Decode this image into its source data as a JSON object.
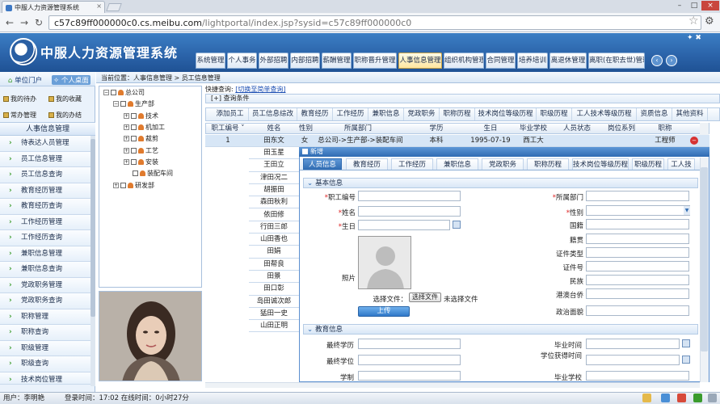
{
  "browser": {
    "tab_title": "中服人力资源管理系统",
    "tab_close": "×",
    "url_host": "c57c89ff000000c0.cs.meibu.com",
    "url_path": "/lightportal/index.jsp?sysid=c57c89ff000000c0",
    "win_min": "–",
    "win_max": "□",
    "win_close": "×"
  },
  "header": {
    "title": "中服人力资源管理系统",
    "top_icons": "✦ ✖",
    "nav": [
      "系统管理",
      "个人事务",
      "外部招聘",
      "内部招聘",
      "薪酬管理",
      "职称晋升管理",
      "人事信息管理",
      "组织机构管理",
      "合同管理",
      "培养培训",
      "离退休管理",
      "离职(在职去世)管理"
    ],
    "active_nav": "人事信息管理",
    "prev": "‹",
    "next": "›"
  },
  "left": {
    "portal": "单位门户",
    "personal_desk": "个人桌面",
    "quick": [
      "我的待办",
      "我的收藏",
      "常办管理",
      "我的办结"
    ],
    "menu_title": "人事信息管理",
    "menu": [
      "待表达人员管理",
      "员工信息管理",
      "员工信息查询",
      "教育经历管理",
      "教育经历查询",
      "工作经历管理",
      "工作经历查询",
      "兼职信息管理",
      "兼职信息查询",
      "党政职务管理",
      "党政职务查询",
      "职称管理",
      "职称查询",
      "职级管理",
      "职级查询",
      "技术岗位管理"
    ]
  },
  "breadcrumb": "当前位置：人事信息管理 > 员工信息管理",
  "tree": {
    "root": "总公司",
    "dept1": "生产部",
    "children": [
      "技术",
      "机加工",
      "裁剪",
      "工艺",
      "安装",
      "装配车间"
    ],
    "dept2": "研发部"
  },
  "query": {
    "quick_label": "快捷查询:",
    "switch_link": "[切换至简单查询]",
    "toggle": "[+]",
    "cond_label": "查询条件"
  },
  "subtabs": [
    "添加员工",
    "员工信息综改",
    "教育经历",
    "工作经历",
    "兼职信息",
    "党政职务",
    "职称历程",
    "技术岗位等级历程",
    "职级历程",
    "工人技术等级历程",
    "资质信息",
    "其他资料"
  ],
  "grid": {
    "columns": [
      "职工编号",
      "姓名",
      "性别",
      "所属部门",
      "学历",
      "生日",
      "毕业学校",
      "人员状态",
      "岗位系列",
      "职称"
    ],
    "sort_mark": "˅",
    "row1": [
      "1",
      "田东文",
      "女",
      "总公司->生产部->装配车间",
      "本科",
      "1995-07-19",
      "西工大",
      "",
      "",
      "工程师"
    ],
    "delete_icon": "−",
    "names": [
      "田玉星",
      "王田立",
      "津田况二",
      "胡振田",
      "森田秋利",
      "依田修",
      "行田三郎",
      "山田香也",
      "田娟",
      "田帮良",
      "田景",
      "田口彰",
      "岛田诚次郎",
      "猛田一史",
      "山田正明"
    ]
  },
  "modal": {
    "title": "新增",
    "tabs": [
      "人员信息",
      "教育经历",
      "工作经历",
      "兼职信息",
      "党政职务",
      "职称历程",
      "技术岗位等级历程",
      "职级历程",
      "工人技"
    ],
    "active_tab": "人员信息",
    "section1": "基本信息",
    "section2": "教育信息",
    "arrow": "⌄",
    "req": "*",
    "labels_left": [
      "职工编号",
      "姓名",
      "生日"
    ],
    "labels_right_req": [
      "所属部门",
      "性别"
    ],
    "labels_right": [
      "国籍",
      "籍贯",
      "证件类型",
      "证件号",
      "民族",
      "港澳台侨",
      "政治面貌"
    ],
    "photo_label": "照片",
    "choose_file_label": "选择文件：",
    "choose_file_btn": "选择文件",
    "no_file": "未选择文件",
    "upload": "上传",
    "edu_left": [
      "最终学历",
      "最终学位",
      "学制"
    ],
    "edu_right": [
      "毕业时间",
      "学位获得时间",
      "毕业学校"
    ]
  },
  "status": {
    "user": "用户：李明艳",
    "login": "登录时间：17:02 在线时间：0小时27分"
  },
  "colors": {
    "header_blue": "#2a62a8",
    "accent_gold": "#ffe7a0",
    "menu_arrow_green": "#3a9b2c",
    "delete_red": "#d73232"
  }
}
